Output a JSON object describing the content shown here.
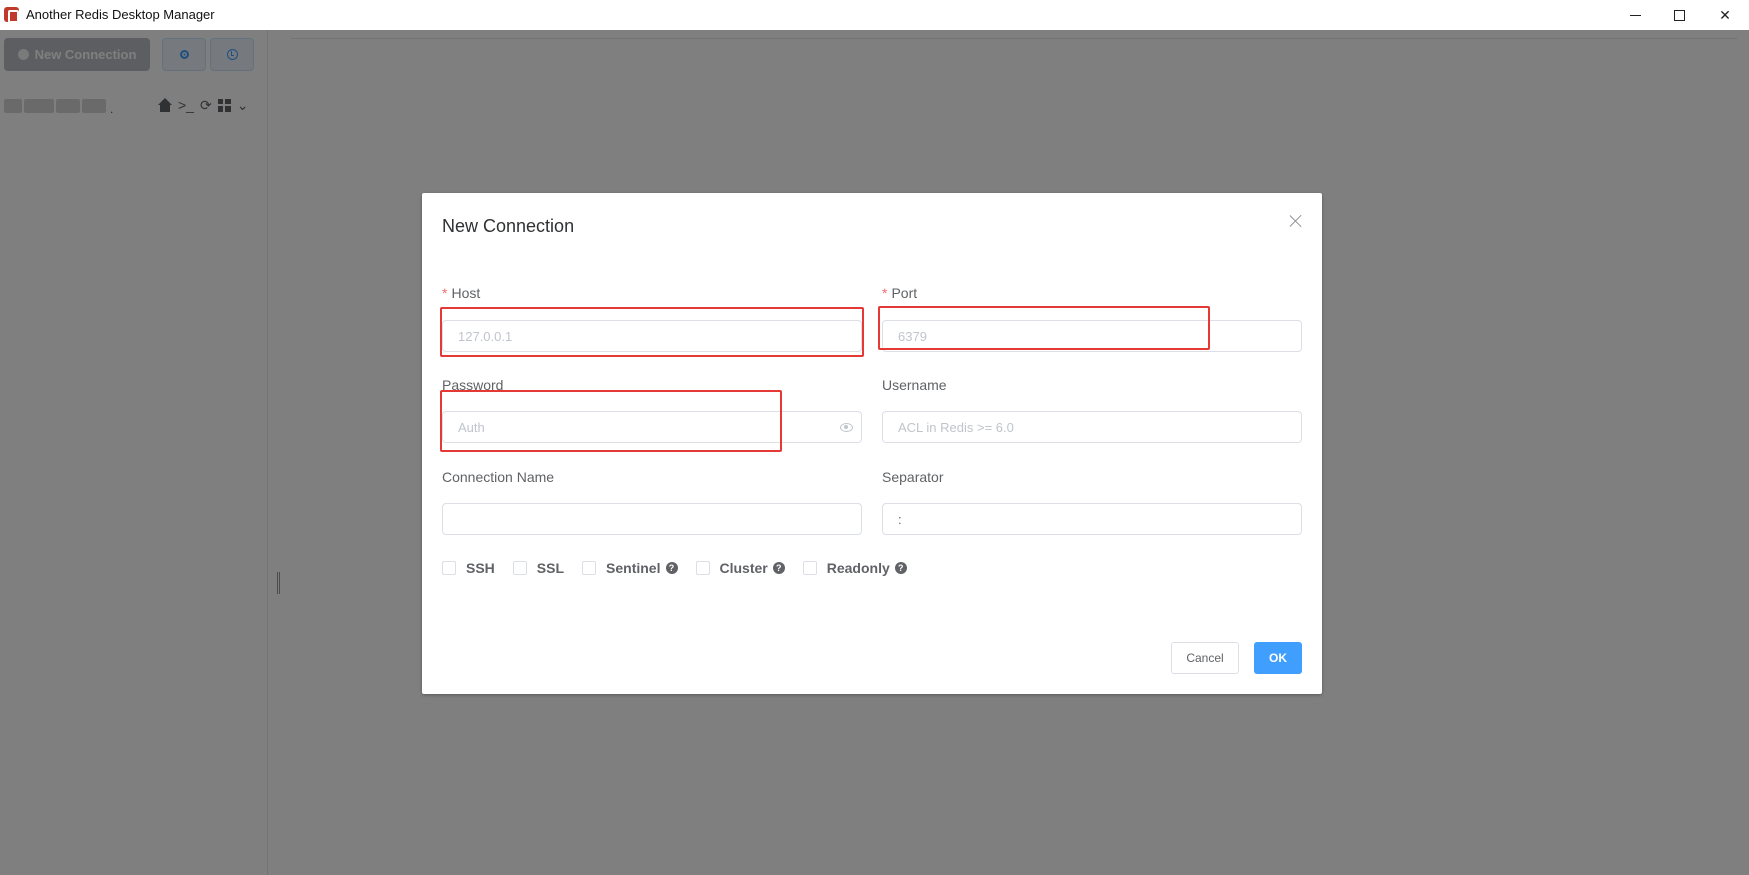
{
  "window": {
    "title": "Another Redis Desktop Manager",
    "minimize_icon": "minimize-icon",
    "maximize_icon": "maximize-icon",
    "close_glyph": "✕"
  },
  "sidebar": {
    "new_connection_label": "New Connection",
    "buttons": [
      "record-icon",
      "history-icon"
    ],
    "connection": {
      "name_suffix": ".",
      "tools": [
        "home-icon",
        "terminal-icon",
        "refresh-icon",
        "grid-icon",
        "chevron-down-icon"
      ],
      "terminal_glyph": ">_",
      "refresh_glyph": "⟳",
      "chevron_glyph": "⌄"
    }
  },
  "dialog": {
    "title": "New Connection",
    "close_glyph": "",
    "fields": {
      "host": {
        "label": "Host",
        "required_mark": "*",
        "placeholder": "127.0.0.1"
      },
      "port": {
        "label": "Port",
        "required_mark": "*",
        "placeholder": "6379"
      },
      "password": {
        "label": "Password",
        "placeholder": "Auth"
      },
      "username": {
        "label": "Username",
        "placeholder": "ACL in Redis >= 6.0"
      },
      "connection_name": {
        "label": "Connection Name",
        "placeholder": ""
      },
      "separator": {
        "label": "Separator",
        "value": ":"
      }
    },
    "options": [
      {
        "label": "SSH",
        "help": false
      },
      {
        "label": "SSL",
        "help": false
      },
      {
        "label": "Sentinel",
        "help": true
      },
      {
        "label": "Cluster",
        "help": true
      },
      {
        "label": "Readonly",
        "help": true
      }
    ],
    "help_glyph": "?",
    "cancel_label": "Cancel",
    "ok_label": "OK"
  },
  "colors": {
    "primary": "#409eff",
    "required": "#f56c6c",
    "highlight_box": "#e53935",
    "overlay": "rgba(0,0,0,0.5)"
  }
}
